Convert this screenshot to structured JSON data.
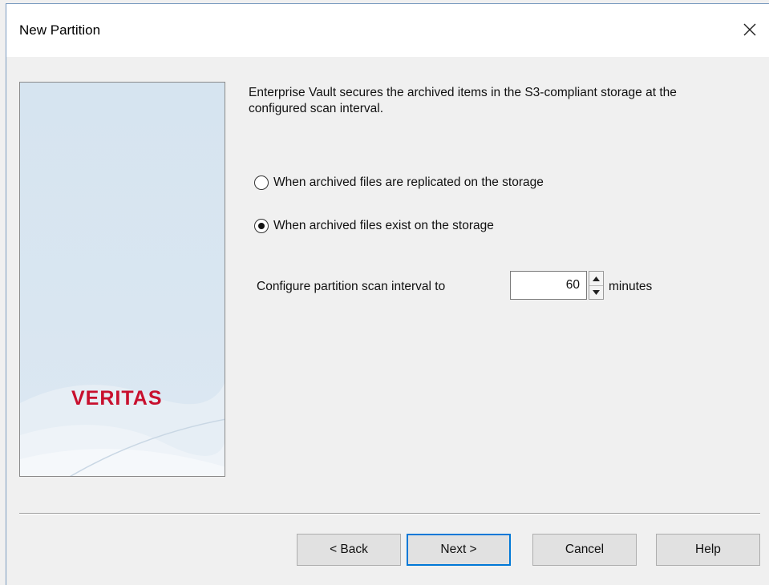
{
  "window": {
    "title": "New Partition",
    "close_symbol": "✕"
  },
  "banner": {
    "logo_text": "VERITAS"
  },
  "content": {
    "description": "Enterprise Vault secures the archived items in the S3-compliant storage at the configured scan interval.",
    "options": [
      {
        "label": "When archived files are replicated on the storage",
        "selected": false
      },
      {
        "label": "When archived files exist on the storage",
        "selected": true
      }
    ],
    "interval": {
      "label": "Configure partition scan interval to",
      "value": "60",
      "units": "minutes"
    }
  },
  "buttons": {
    "back": "< Back",
    "next": "Next >",
    "cancel": "Cancel",
    "help": "Help"
  },
  "colors": {
    "logo": "#c8102e",
    "default_button_border": "#0078d7",
    "banner_background": "#d6e4f0"
  }
}
